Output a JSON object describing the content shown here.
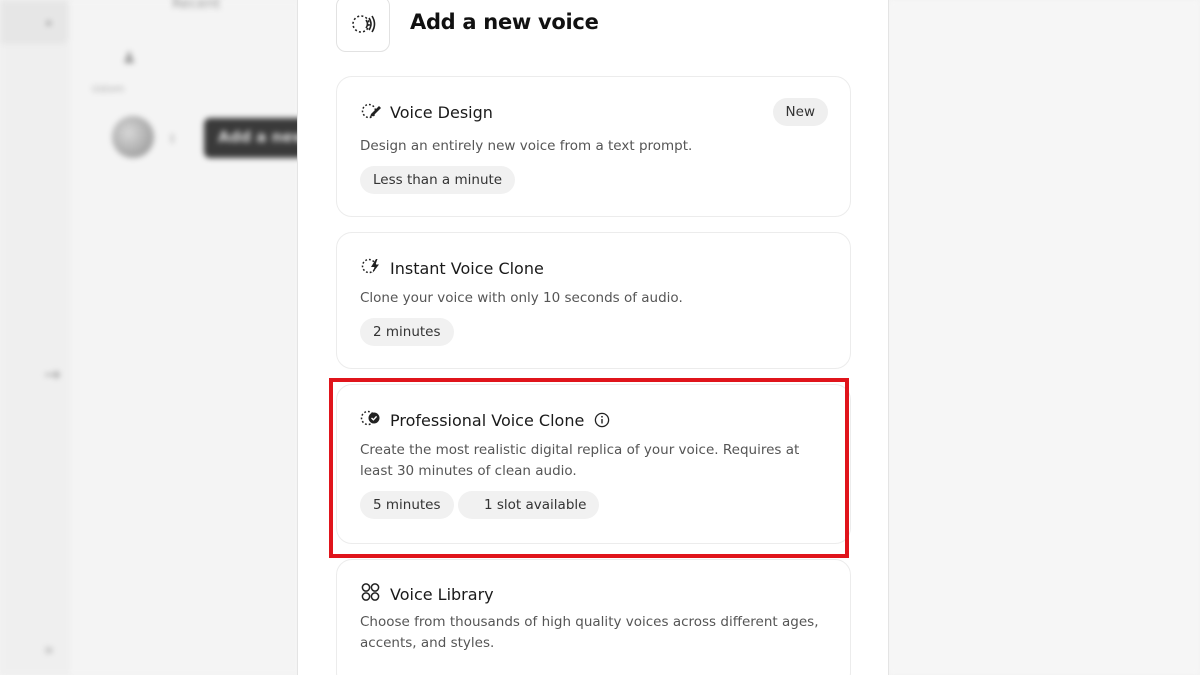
{
  "background": {
    "recent_label": "Recent",
    "side_caption": "Ustom",
    "tooltip_text": "Add a new"
  },
  "header": {
    "title": "Add a new voice",
    "icon": "voice-waves-icon"
  },
  "cards": [
    {
      "title": "Voice Design",
      "icon": "voice-design-icon",
      "badge": "New",
      "description": "Design an entirely new voice from a text prompt.",
      "chips": [
        "Less than a minute"
      ]
    },
    {
      "title": "Instant Voice Clone",
      "icon": "lightning-icon",
      "description": "Clone your voice with only 10 seconds of audio.",
      "chips": [
        "2 minutes"
      ]
    },
    {
      "title": "Professional Voice Clone",
      "icon": "verified-badge-icon",
      "description": "Create the most realistic digital replica of your voice. Requires at least 30 minutes of clean audio.",
      "chips": [
        "5 minutes",
        "1 slot available"
      ]
    },
    {
      "title": "Voice Library",
      "icon": "grid-icon",
      "description": "Choose from thousands of high quality voices across different ages, accents, and styles."
    }
  ],
  "colors": {
    "highlight": "#e0141b",
    "card_border": "#ececec",
    "chip_bg": "#f1f1f1"
  }
}
